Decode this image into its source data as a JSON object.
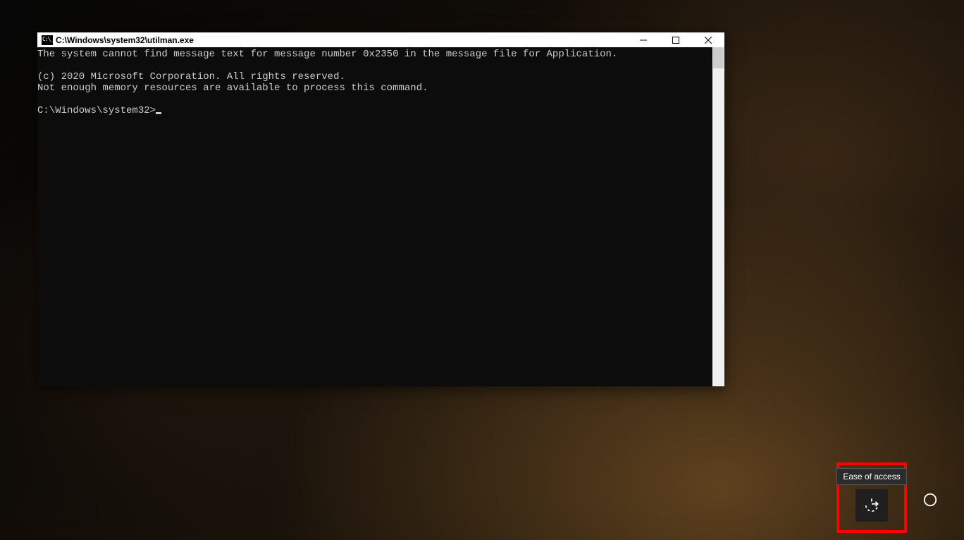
{
  "window": {
    "title": "C:\\Windows\\system32\\utilman.exe"
  },
  "console": {
    "line1": "The system cannot find message text for message number 0x2350 in the message file for Application.",
    "blank1": "",
    "line2": "(c) 2020 Microsoft Corporation. All rights reserved.",
    "line3": "Not enough memory resources are available to process this command.",
    "blank2": "",
    "prompt": "C:\\Windows\\system32>"
  },
  "login_controls": {
    "ease_of_access_tooltip": "Ease of access"
  }
}
